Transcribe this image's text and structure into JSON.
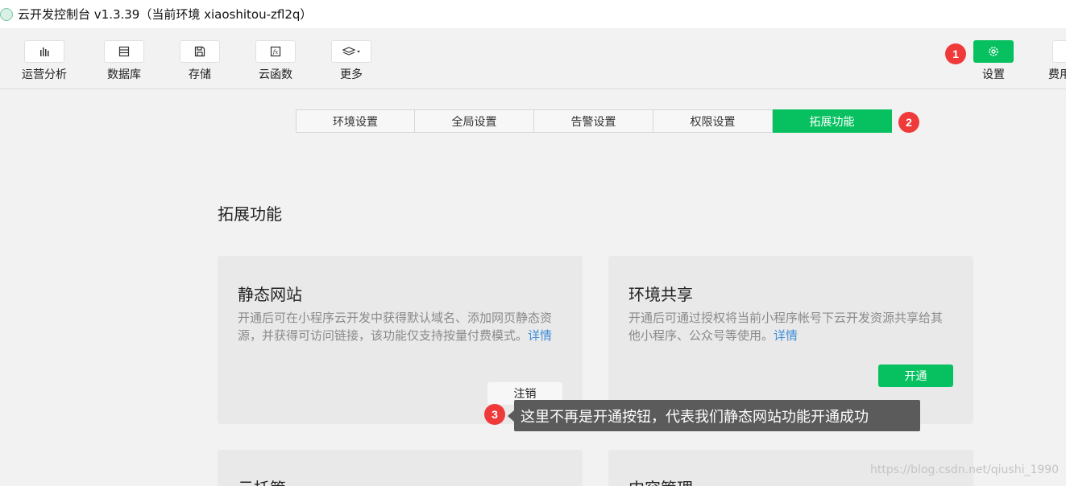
{
  "window": {
    "title": "云开发控制台 v1.3.39（当前环境 xiaoshitou-zfl2q）"
  },
  "toolbar": {
    "items": [
      {
        "label": "运营分析",
        "icon": "bar-chart-icon"
      },
      {
        "label": "数据库",
        "icon": "database-icon"
      },
      {
        "label": "存储",
        "icon": "save-icon"
      },
      {
        "label": "云函数",
        "icon": "function-icon"
      },
      {
        "label": "更多",
        "icon": "layers-icon"
      }
    ],
    "settings_label": "设置",
    "cost_label": "费用",
    "accent_color": "#07c160"
  },
  "badges": [
    "1",
    "2",
    "3"
  ],
  "tabs": [
    {
      "label": "环境设置",
      "active": false
    },
    {
      "label": "全局设置",
      "active": false
    },
    {
      "label": "告警设置",
      "active": false
    },
    {
      "label": "权限设置",
      "active": false
    },
    {
      "label": "拓展功能",
      "active": true
    }
  ],
  "section": {
    "title": "拓展功能"
  },
  "cards": [
    {
      "title": "静态网站",
      "description": "开通后可在小程序云开发中获得默认域名、添加网页静态资源，并获得可访问链接，该功能仅支持按量付费模式。",
      "link": "详情",
      "button": "注销"
    },
    {
      "title": "环境共享",
      "description": "开通后可通过授权将当前小程序帐号下云开发资源共享给其他小程序、公众号等使用。",
      "link": "详情",
      "button": "开通"
    },
    {
      "title": "云托管"
    },
    {
      "title": "内容管理"
    }
  ],
  "tooltip": {
    "text": "这里不再是开通按钮，代表我们静态网站功能开通成功"
  },
  "watermark": "https://blog.csdn.net/qiushi_1990"
}
